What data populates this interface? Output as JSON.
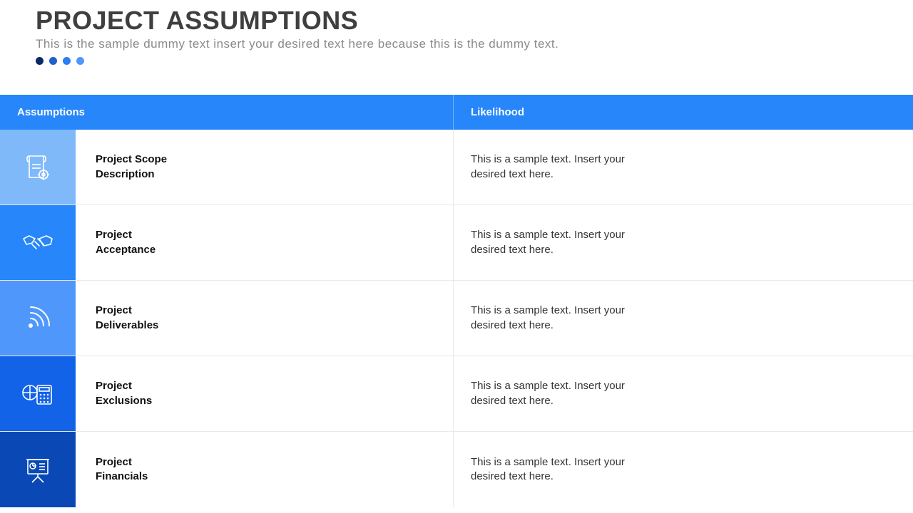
{
  "header": {
    "title": "PROJECT ASSUMPTIONS",
    "subtitle": "This is the sample dummy text insert your desired text here because this is the dummy text.",
    "dot_colors": [
      "#0a2a66",
      "#1c60d1",
      "#2b7df5",
      "#4f97fb"
    ]
  },
  "table": {
    "headers": {
      "assumptions": "Assumptions",
      "likelihood": "Likelihood"
    },
    "rows": [
      {
        "label_line1": "Project Scope",
        "label_line2": "Description",
        "likelihood_line1": "This is a sample text. Insert your",
        "likelihood_line2": "desired text here.",
        "icon": "scope-doc-gear-icon",
        "icon_bg": "#7fb9fa"
      },
      {
        "label_line1": "Project",
        "label_line2": "Acceptance",
        "likelihood_line1": "This is a sample text. Insert your",
        "likelihood_line2": "desired text here.",
        "icon": "handshake-icon",
        "icon_bg": "#2686fa"
      },
      {
        "label_line1": "Project",
        "label_line2": "Deliverables",
        "likelihood_line1": "This is a sample text. Insert your",
        "likelihood_line2": "desired text here.",
        "icon": "signal-icon",
        "icon_bg": "#4f97fb"
      },
      {
        "label_line1": "Project",
        "label_line2": "Exclusions",
        "likelihood_line1": "This is a sample text. Insert your",
        "likelihood_line2": "desired text here.",
        "icon": "building-calc-icon",
        "icon_bg": "#1263e8"
      },
      {
        "label_line1": "Project",
        "label_line2": "Financials",
        "likelihood_line1": "This is a sample text. Insert your",
        "likelihood_line2": "desired text here.",
        "icon": "presentation-chart-icon",
        "icon_bg": "#0a49b5"
      }
    ]
  }
}
